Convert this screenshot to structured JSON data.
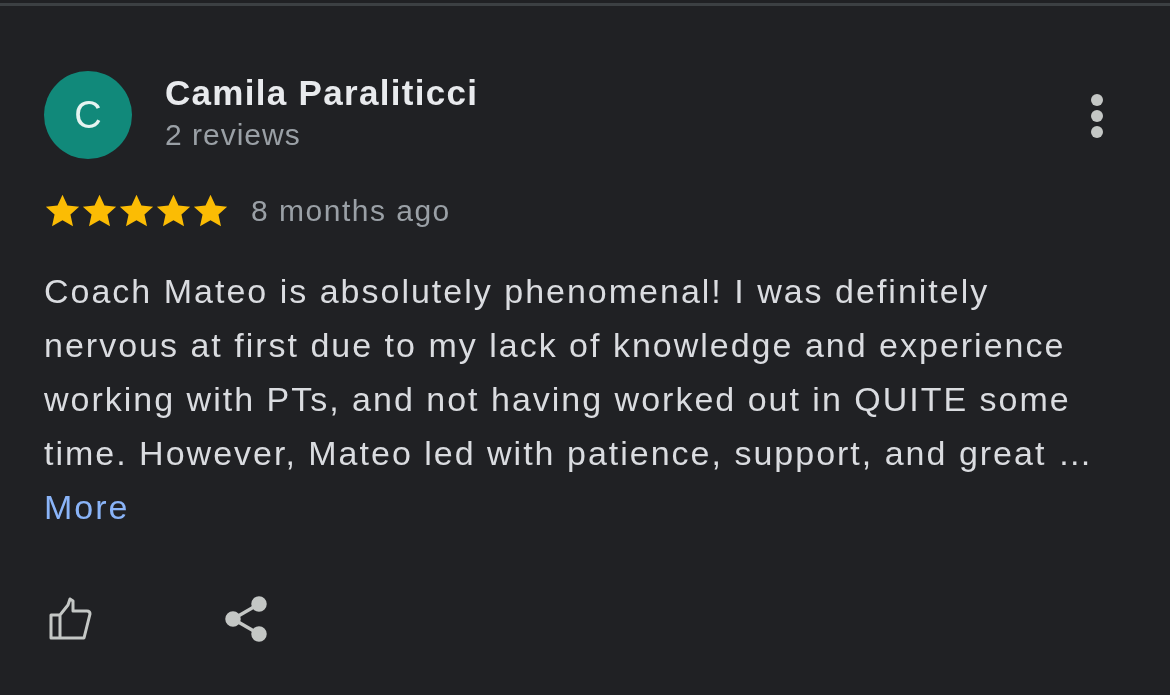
{
  "review": {
    "author": {
      "initial": "C",
      "name": "Camila Paraliticci",
      "meta": "2 reviews"
    },
    "stars": 5,
    "time": "8 months ago",
    "text": "Coach Mateo is absolutely phenomenal! I was definitely nervous at first due to my lack of knowledge and experience working with PTs, and not having worked out in QUITE some time. However, Mateo led with patience, support, and great …",
    "more_link": "More"
  }
}
